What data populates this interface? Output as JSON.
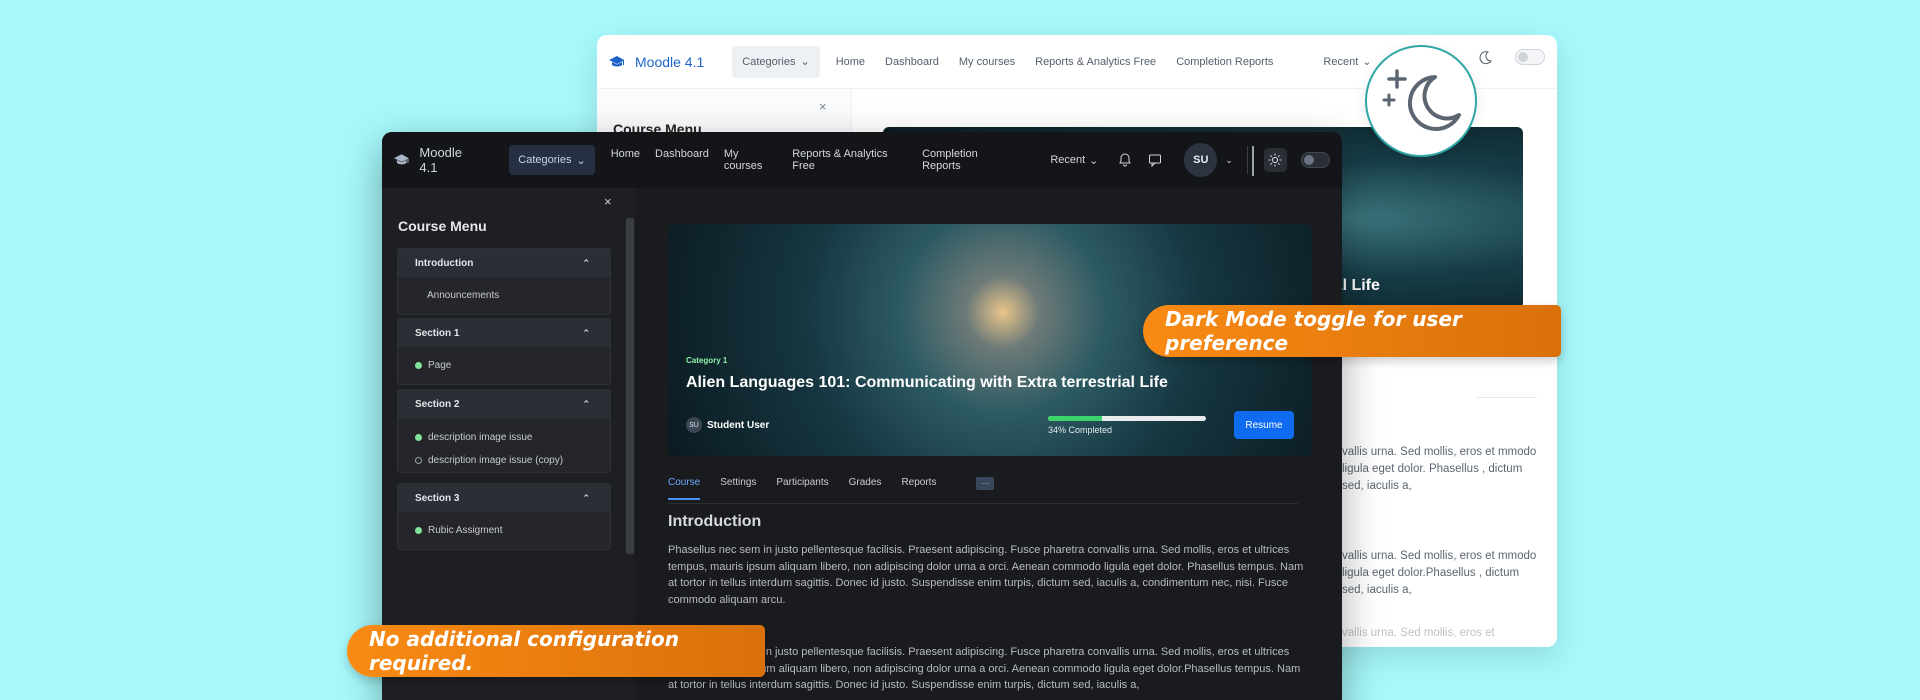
{
  "brand": {
    "name": "Moodle 4.1"
  },
  "nav": {
    "categories": "Categories",
    "links": [
      "Home",
      "Dashboard",
      "My courses",
      "Reports & Analytics Free",
      "Completion Reports"
    ],
    "recent": "Recent",
    "avatar_initials": "SU"
  },
  "sidebar": {
    "close": "×",
    "title": "Course Menu",
    "sections": [
      {
        "title": "Introduction",
        "items": [
          {
            "label": "Announcements",
            "marker": "none"
          }
        ]
      },
      {
        "title": "Section 1",
        "items": [
          {
            "label": "Page",
            "marker": "done"
          }
        ]
      },
      {
        "title": "Section 2",
        "items": [
          {
            "label": "description image issue",
            "marker": "done"
          },
          {
            "label": "description image issue (copy)",
            "marker": "empty"
          }
        ]
      },
      {
        "title": "Section 3",
        "items": [
          {
            "label": "Rubic Assigment",
            "marker": "done"
          }
        ]
      }
    ]
  },
  "course": {
    "category": "Category 1",
    "title": "Alien Languages 101: Communicating with Extra terrestrial Life",
    "student_initials": "SU",
    "student": "Student User",
    "progress": 0.34,
    "progress_label": "34% Completed",
    "resume": "Resume"
  },
  "tabs": [
    "Course",
    "Settings",
    "Participants",
    "Grades",
    "Reports"
  ],
  "more": "···",
  "content": {
    "heading": "Introduction",
    "para1": "Phasellus nec sem in justo pellentesque facilisis. Praesent adipiscing. Fusce pharetra convallis urna. Sed mollis, eros et ultrices tempus, mauris ipsum aliquam libero, non adipiscing dolor urna a orci. Aenean commodo ligula eget dolor. Phasellus tempus. Nam at tortor in tellus interdum sagittis. Donec id justo. Suspendisse enim turpis, dictum sed, iaculis a, condimentum nec, nisi. Fusce commodo aliquam arcu.",
    "para2": "Phasellus nec sem in justo pellentesque facilisis. Praesent adipiscing. Fusce pharetra convallis urna. Sed mollis, eros et ultrices tempus, mauris ipsum aliquam libero, non adipiscing dolor urna a orci. Aenean commodo ligula eget dolor.Phasellus tempus. Nam at tortor in tellus interdum sagittis. Donec id justo. Suspendisse enim turpis, dictum sed, iaculis a,"
  },
  "light": {
    "hero_title_partial": "rial Life",
    "para1_partial": "vallis urna. Sed mollis, eros et mmodo ligula eget dolor. Phasellus , dictum sed, iaculis a,",
    "para2_partial": "vallis urna. Sed mollis, eros et mmodo ligula eget dolor.Phasellus , dictum sed, iaculis a,",
    "para3_partial": "vallis urna. Sed mollis, eros et"
  },
  "callouts": {
    "dark_mode": "Dark Mode toggle for user preference",
    "no_config": "No additional configuration required."
  },
  "colors": {
    "accent": "#0f6cf0",
    "callout": "#f98b14",
    "background": "#a6f8fb",
    "progress": "#3bd36a"
  }
}
